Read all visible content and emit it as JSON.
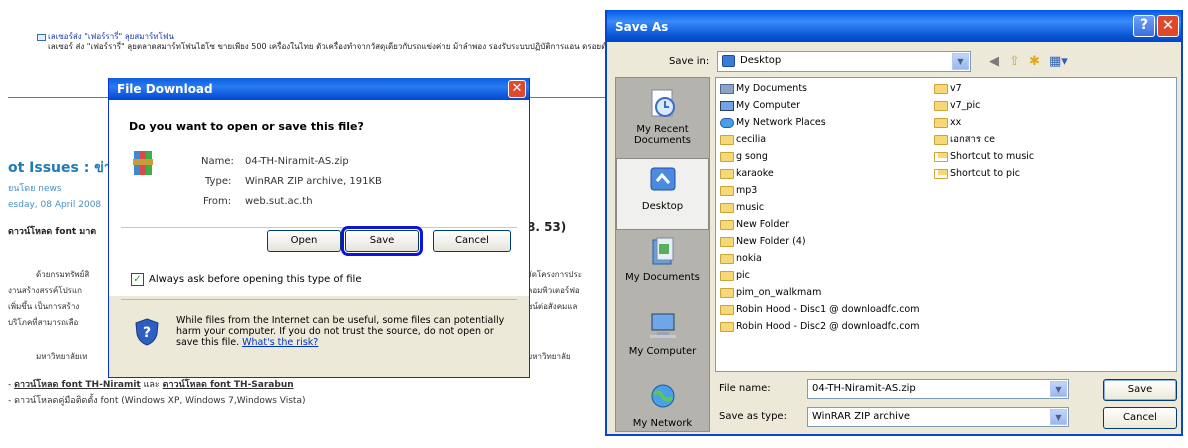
{
  "webpage": {
    "news_title": "เลเซอร์ส่ง \"เฟอร์รารี่\" ลุยสมาร์ทโฟน",
    "news_desc": "เลเซอร์ ส่ง \"เฟอร์รารี่\" ลุยตลาดสมาร์ทโฟนไฮโซ ขายเพียง 500 เครื่องในไทย ตัวเครื่องทำจากวัสดุเดียวกับรถแข่งค่าย ม้าลำพอง รองรับระบบปฏิบัติการแอน ดรอยด์",
    "hot_title": "ot Issues : ข่าว",
    "meta_author": "ยนโดย news",
    "meta_date": "esday, 08 April 2008",
    "download_heading_left": "ดาวน์โหลด font มาต",
    "download_heading_right": "8. 53)",
    "para_left": [
      "ด้วยกรมทรัพย์สิ",
      "งานสร้างสรรค์โปรแก",
      "เพิ่มขึ้น เป็นการสร้าง",
      "บริโภคที่สามารถเลือ",
      "มหาวิทยาลัยเท"
    ],
    "para_right": [
      "จัดโครงการประ",
      "คอมพิวเตอร์ฟอ",
      "ชน์ต่อสังคมแล",
      "",
      "มหาวิทยาลัย"
    ],
    "link_prefix": "- ",
    "link1": "ดาวน์โหลด font TH-Niramit",
    "link_and": " และ ",
    "link2": "ดาวน์โหลด font TH-Sarabun",
    "link_line2": "- ดาวน์โหลดคู่มือติดตั้ง font (Windows XP, Windows 7,Windows Vista)"
  },
  "file_download": {
    "title": "File Download",
    "close_glyph": "✕",
    "question": "Do you want to open or save this file?",
    "name_label": "Name:",
    "name_value": "04-TH-Niramit-AS.zip",
    "type_label": "Type:",
    "type_value": "WinRAR ZIP archive, 191KB",
    "from_label": "From:",
    "from_value": "web.sut.ac.th",
    "open_label": "Open",
    "save_label": "Save",
    "cancel_label": "Cancel",
    "always_ask_label": "Always ask before opening this type of file",
    "warning_text": "While files from the Internet can be useful, some files can potentially harm your computer. If you do not trust the source, do not open or save this file.",
    "risk_link": "What's the risk?"
  },
  "save_as": {
    "title": "Save As",
    "help_glyph": "?",
    "close_glyph": "✕",
    "save_in_label": "Save in:",
    "save_in_value": "Desktop",
    "places": [
      {
        "label": "My Recent Documents",
        "icon": "recent-documents-icon"
      },
      {
        "label": "Desktop",
        "icon": "desktop-icon"
      },
      {
        "label": "My Documents",
        "icon": "my-documents-icon"
      },
      {
        "label": "My Computer",
        "icon": "my-computer-icon"
      },
      {
        "label": "My Network",
        "icon": "my-network-icon"
      }
    ],
    "files_col1": [
      "My Documents",
      "My Computer",
      "My Network Places",
      "cecilia",
      "g song",
      "karaoke",
      "mp3",
      "music",
      "New Folder",
      "New Folder (4)",
      "nokia",
      "pic",
      "pim_on_walkmam",
      "Robin Hood - Disc1 @ downloadfc.com",
      "Robin Hood - Disc2 @ downloadfc.com"
    ],
    "files_col2": [
      "v7",
      "v7_pic",
      "xx",
      "เอกสาร ce",
      "Shortcut to music",
      "Shortcut to pic"
    ],
    "file_name_label": "File name:",
    "file_name_value": "04-TH-Niramit-AS.zip",
    "save_type_label": "Save as type:",
    "save_type_value": "WinRAR ZIP archive",
    "save_button": "Save",
    "cancel_button": "Cancel"
  }
}
